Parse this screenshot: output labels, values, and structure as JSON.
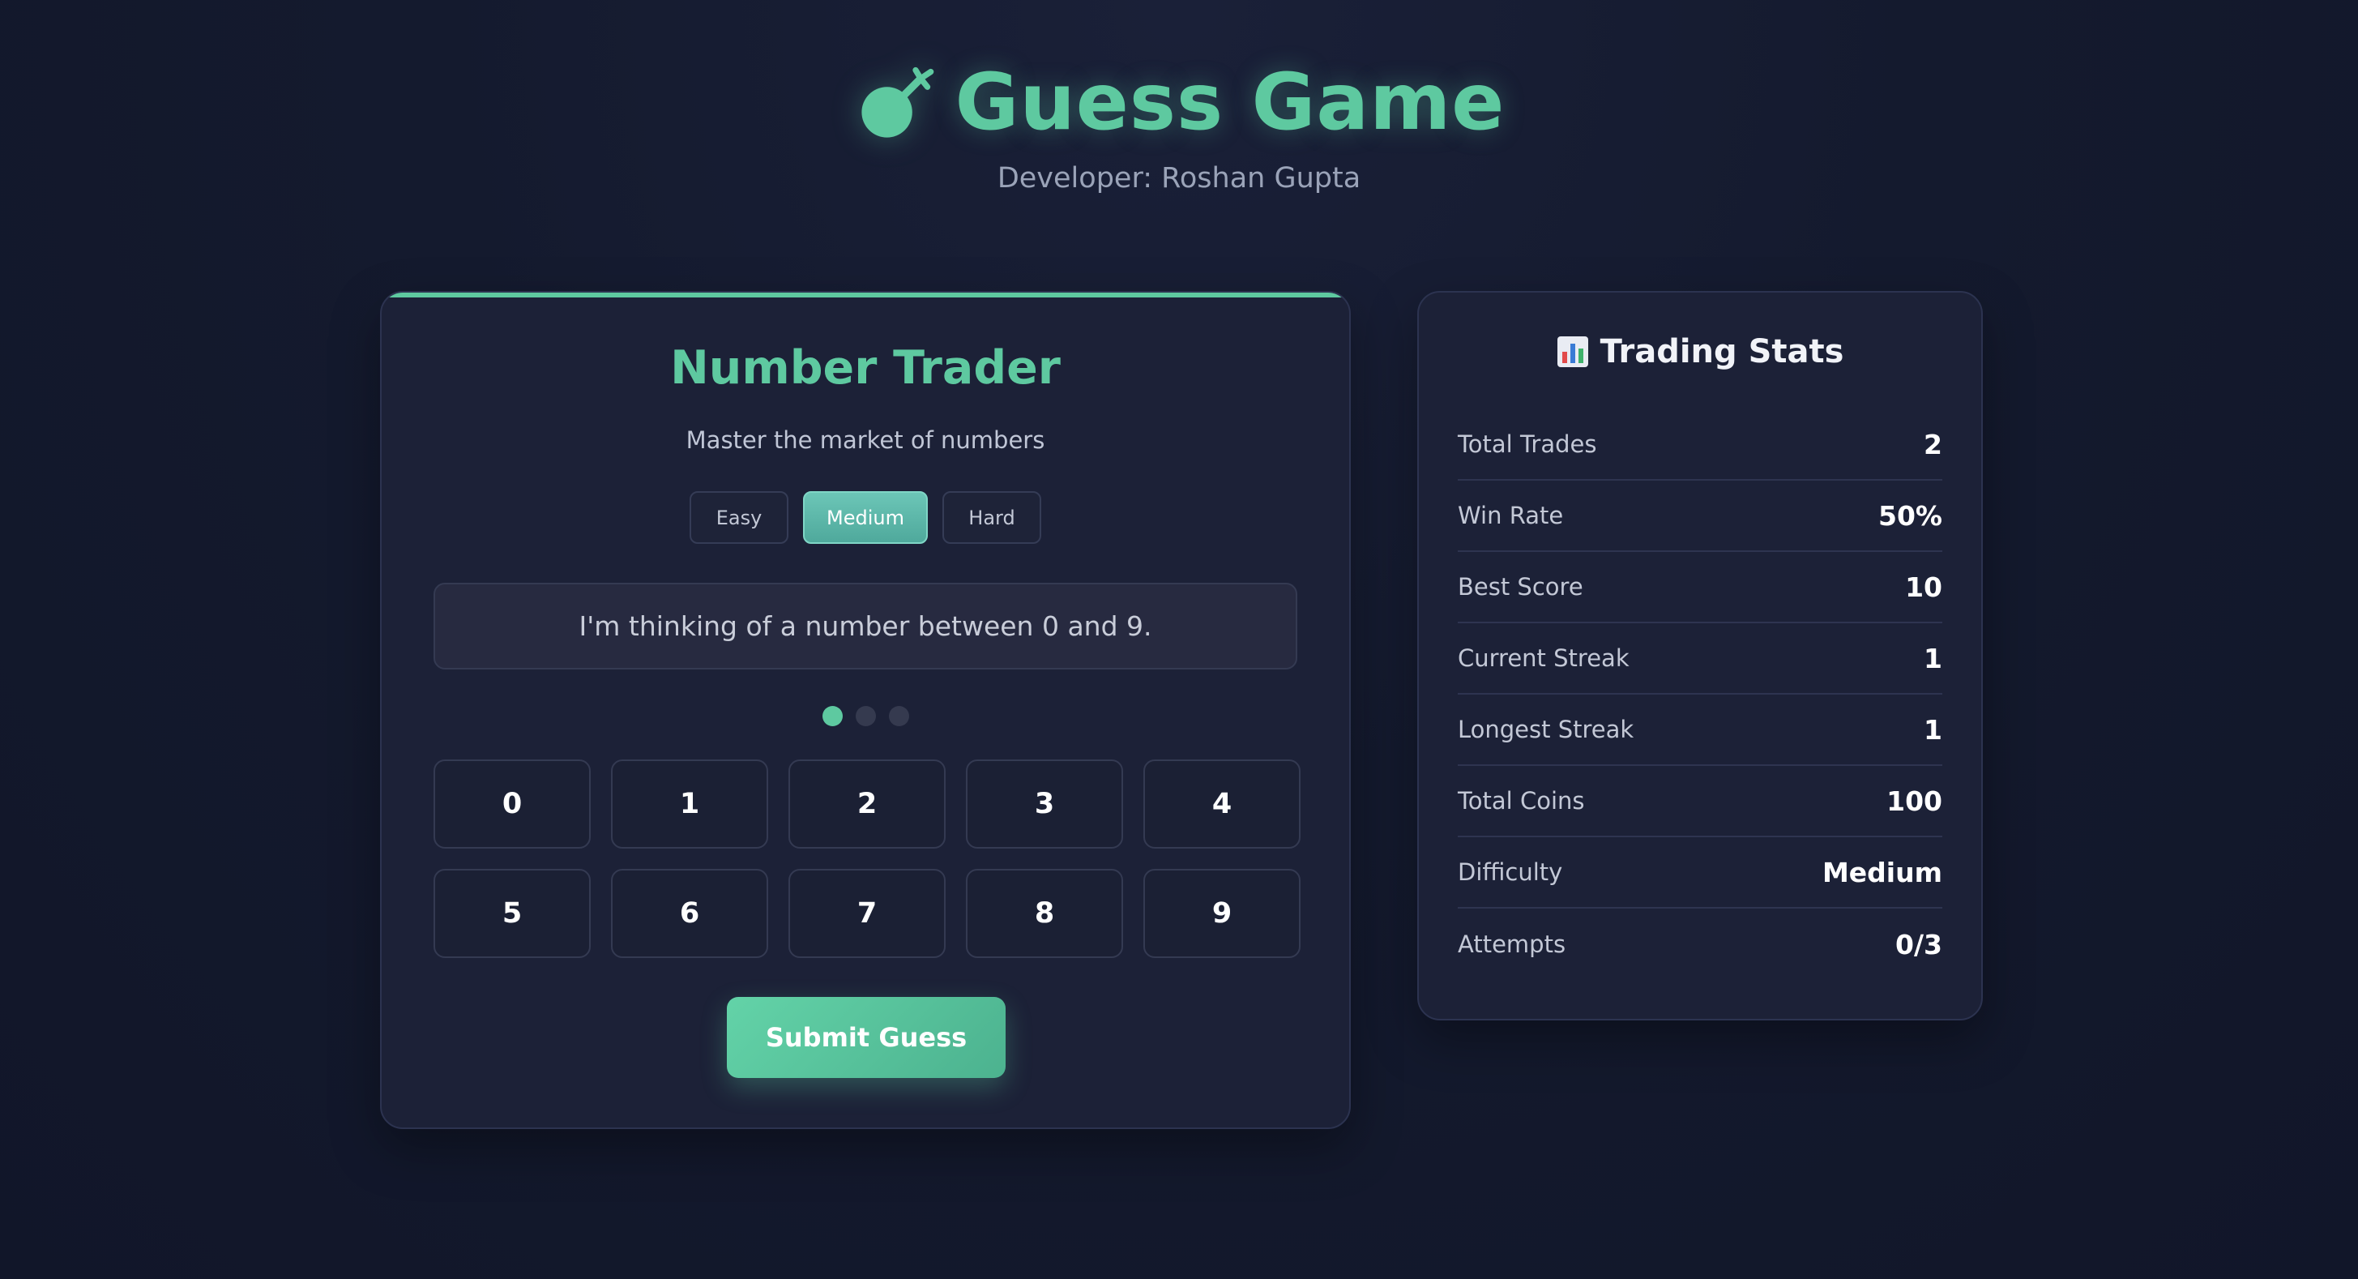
{
  "header": {
    "title": "Guess Game",
    "developer": "Developer: Roshan Gupta",
    "logo_icon": "broccoli-icon"
  },
  "game": {
    "title": "Number Trader",
    "subtitle": "Master the market of numbers",
    "difficulties": [
      {
        "label": "Easy",
        "selected": false
      },
      {
        "label": "Medium",
        "selected": true
      },
      {
        "label": "Hard",
        "selected": false
      }
    ],
    "message": "I'm thinking of a number between 0 and 9.",
    "attempt_dots": {
      "total": 3,
      "active": 1
    },
    "numbers": [
      "0",
      "1",
      "2",
      "3",
      "4",
      "5",
      "6",
      "7",
      "8",
      "9"
    ],
    "submit_label": "Submit Guess"
  },
  "stats": {
    "title": "Trading Stats",
    "title_icon": "bar-chart-icon",
    "rows": [
      {
        "label": "Total Trades",
        "value": "2"
      },
      {
        "label": "Win Rate",
        "value": "50%"
      },
      {
        "label": "Best Score",
        "value": "10"
      },
      {
        "label": "Current Streak",
        "value": "1"
      },
      {
        "label": "Longest Streak",
        "value": "1"
      },
      {
        "label": "Total Coins",
        "value": "100"
      },
      {
        "label": "Difficulty",
        "value": "Medium"
      },
      {
        "label": "Attempts",
        "value": "0/3"
      }
    ]
  },
  "colors": {
    "accent": "#5ec9a0",
    "background": "#141a2e",
    "card": "#1c2137"
  }
}
